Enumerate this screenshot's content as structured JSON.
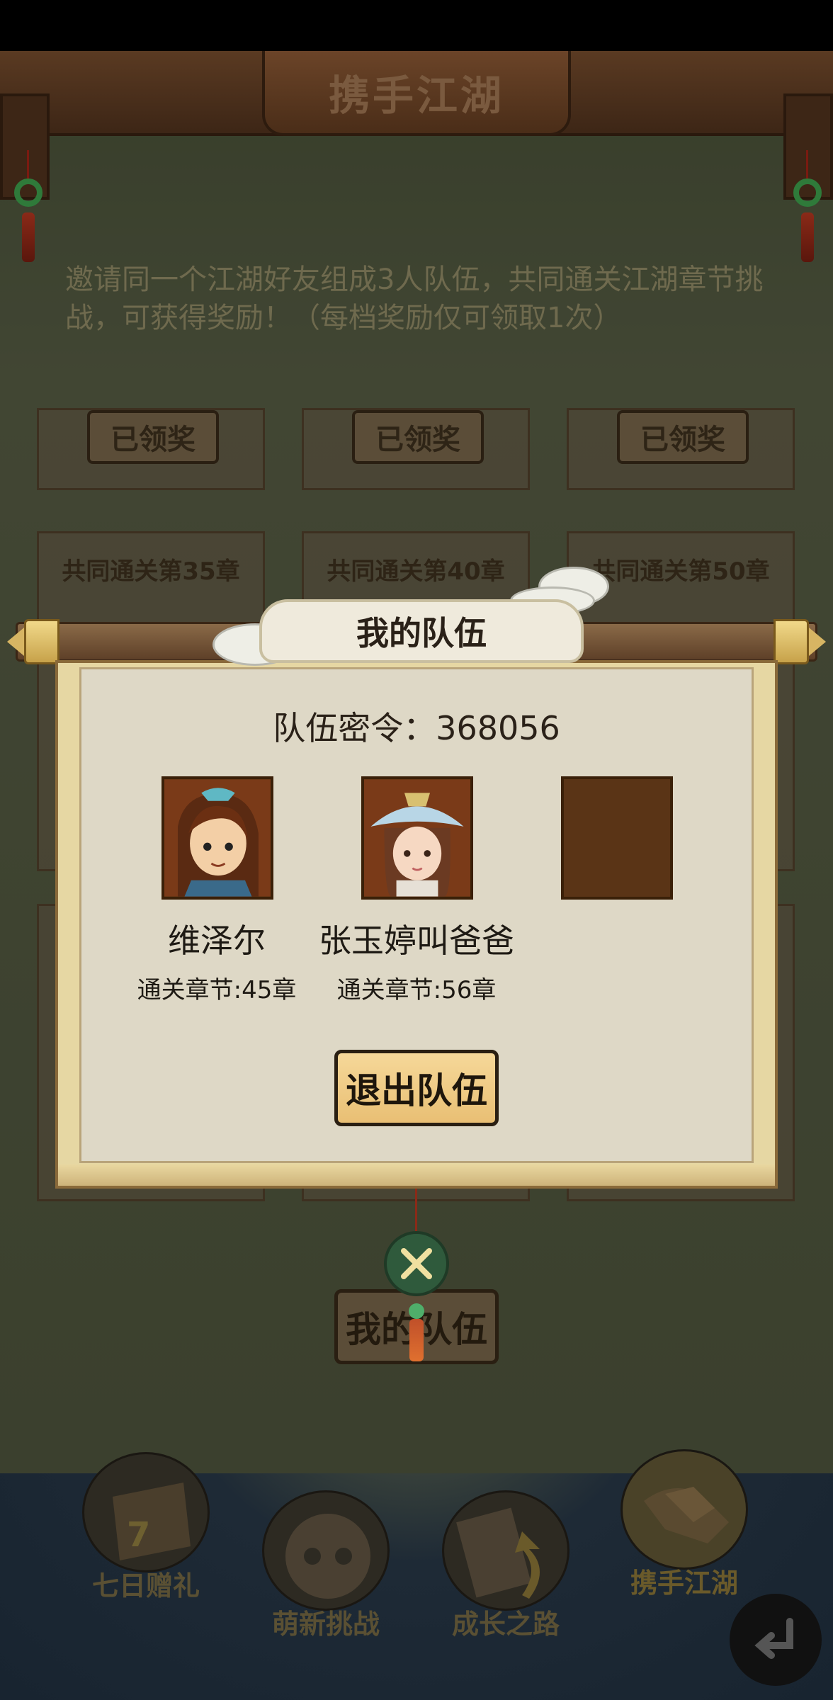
{
  "header": {
    "title": "携手江湖"
  },
  "instruction": "邀请同一个江湖好友组成3人队伍，共同通关江湖章节挑战，可获得奖励！（每档奖励仅可领取1次）",
  "reward_rows": [
    {
      "tiles": [
        {
          "button": "已领奖"
        },
        {
          "button": "已领奖"
        },
        {
          "button": "已领奖"
        }
      ]
    },
    {
      "tiles": [
        {
          "label": "共同通关第35章"
        },
        {
          "label": "共同通关第40章"
        },
        {
          "label": "共同通关第50章"
        }
      ]
    }
  ],
  "dialog": {
    "title": "我的队伍",
    "team_code_label": "队伍密令：",
    "team_code_value": "368056",
    "members": [
      {
        "name": "维泽尔",
        "chapter": "通关章节:45章",
        "avatar": "swordsman-avatar"
      },
      {
        "name": "张玉婷叫爸爸",
        "chapter": "通关章节:56章",
        "avatar": "hat-girl-avatar"
      },
      {
        "empty": true
      }
    ],
    "leave_button": "退出队伍"
  },
  "my_team_button": "我的队伍",
  "bottom_nav": [
    {
      "label": "七日赠礼",
      "icon": "gift-box-icon",
      "badge": "7"
    },
    {
      "label": "萌新挑战",
      "icon": "face-icon"
    },
    {
      "label": "成长之路",
      "icon": "book-arrow-icon"
    },
    {
      "label": "携手江湖",
      "icon": "handshake-icon",
      "active": true
    }
  ],
  "colors": {
    "dialog_bg": "#ded8c6",
    "button_gold": "#f2cf8c",
    "slot_brown": "#5a3416"
  }
}
